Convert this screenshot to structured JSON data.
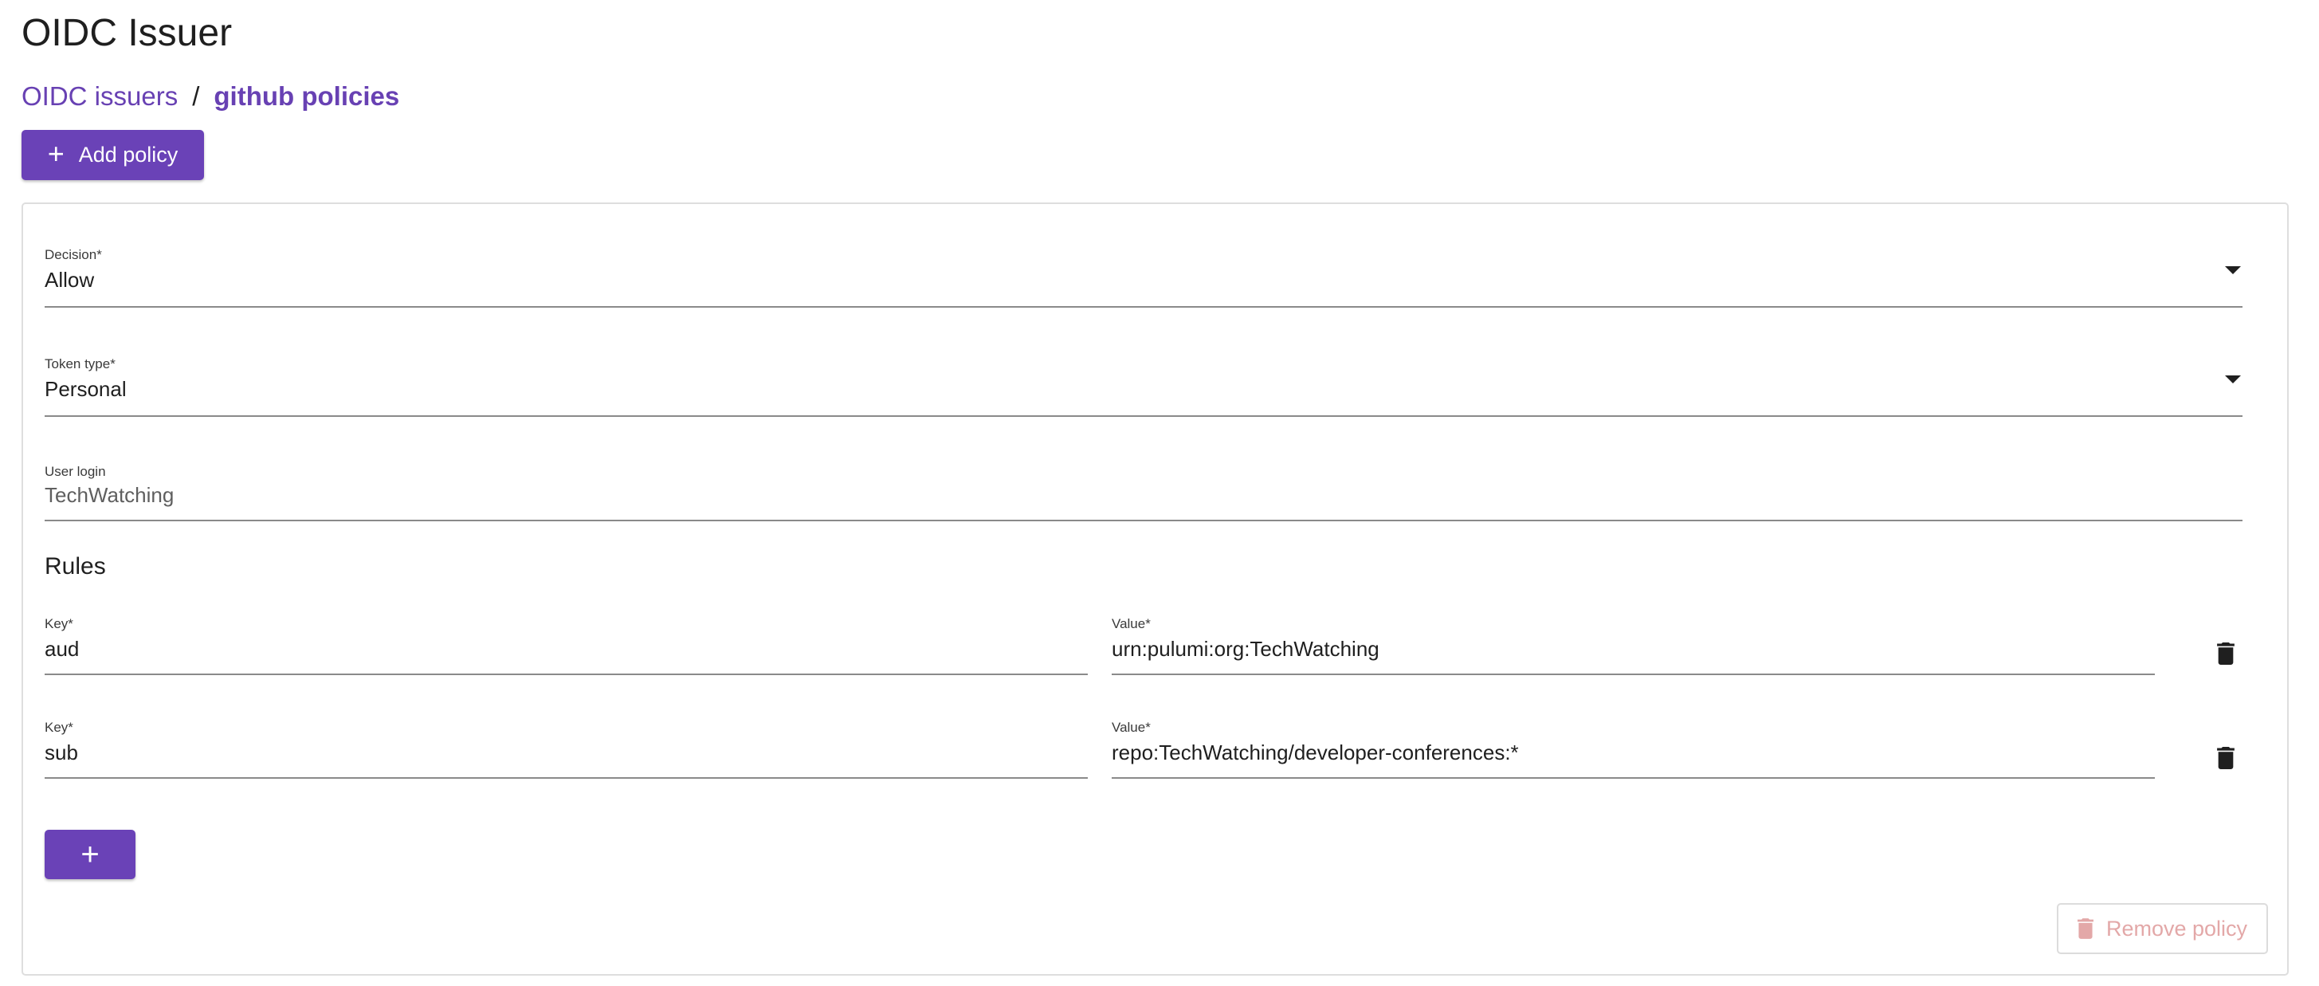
{
  "page": {
    "title": "OIDC Issuer"
  },
  "breadcrumb": {
    "parent": "OIDC issuers",
    "separator": "/",
    "current": "github policies"
  },
  "toolbar": {
    "add_policy_label": "Add policy"
  },
  "policy": {
    "decision": {
      "label": "Decision",
      "required_mark": "*",
      "value": "Allow"
    },
    "token_type": {
      "label": "Token type",
      "required_mark": "*",
      "value": "Personal"
    },
    "user_login": {
      "label": "User login",
      "value": "TechWatching"
    },
    "rules_heading": "Rules",
    "rules": [
      {
        "key_label": "Key*",
        "key": "aud",
        "value_label": "Value*",
        "value": "urn:pulumi:org:TechWatching"
      },
      {
        "key_label": "Key*",
        "key": "sub",
        "value_label": "Value*",
        "value": "repo:TechWatching/developer-conferences:*"
      }
    ],
    "add_rule_label": "+",
    "remove_policy_label": "Remove policy"
  },
  "colors": {
    "accent": "#6a42b7",
    "link": "#6841b3",
    "disabled_danger": "#e3a8a8"
  },
  "icons": {
    "add": "plus-icon",
    "dropdown": "caret-down-icon",
    "delete": "trash-icon"
  }
}
